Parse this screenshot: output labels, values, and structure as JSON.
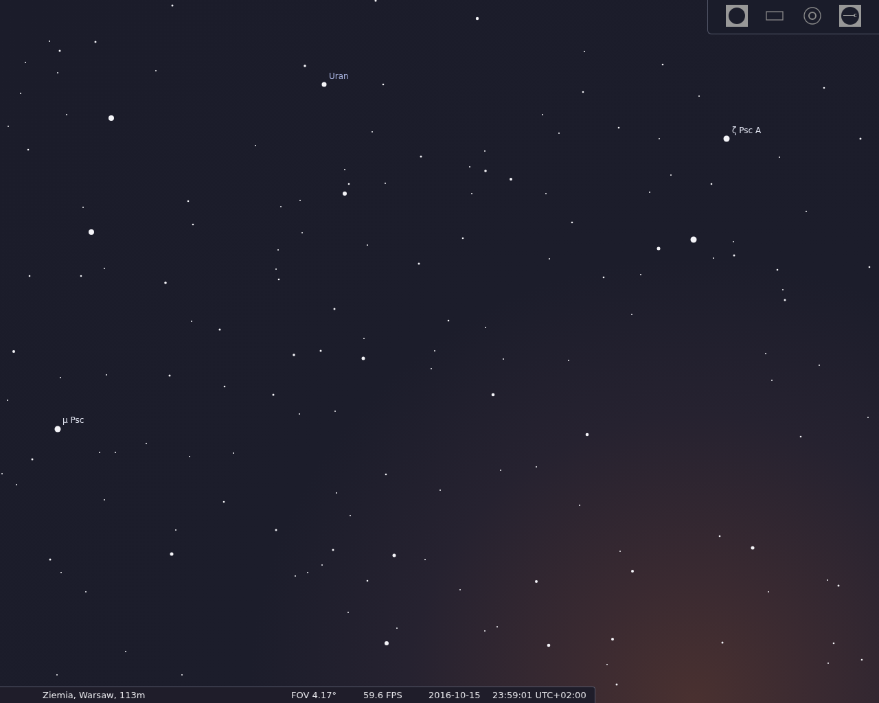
{
  "sky_labels": [
    {
      "text": "Uran"
    },
    {
      "text": "ζ Psc A"
    },
    {
      "text": "μ Psc"
    }
  ],
  "toolbar": [
    {
      "kind": "disc",
      "on": true
    },
    {
      "kind": "frame",
      "on": false
    },
    {
      "kind": "target",
      "on": false
    },
    {
      "kind": "wrench",
      "on": true
    }
  ],
  "status_bar": {
    "location": "Ziemia, Warsaw, 113m",
    "fov": "FOV 4.17°",
    "fps": "59.6 FPS",
    "date": "2016-10-15",
    "time": "23:59:01 UTC+02:00"
  }
}
